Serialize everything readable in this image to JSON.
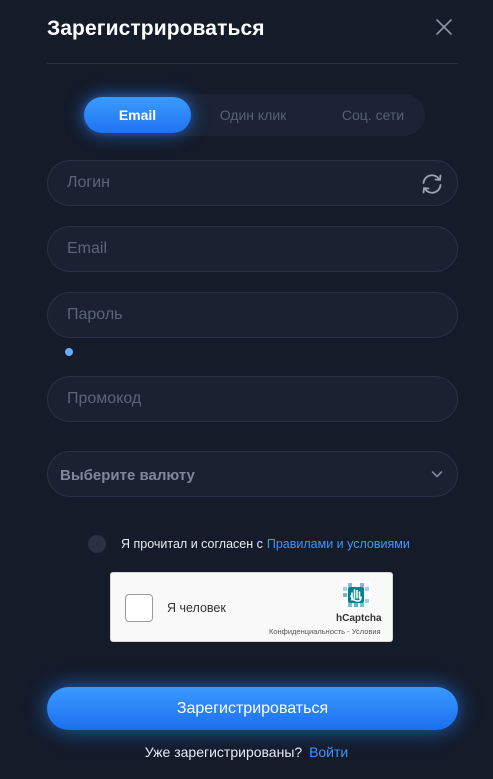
{
  "header": {
    "title": "Зарегистрироваться",
    "close_icon": "close-icon"
  },
  "tabs": [
    {
      "label": "Email",
      "active": true
    },
    {
      "label": "Один клик",
      "active": false
    },
    {
      "label": "Соц. сети",
      "active": false
    }
  ],
  "form": {
    "login": {
      "placeholder": "Логин",
      "value": "",
      "icon": "refresh-icon"
    },
    "email": {
      "placeholder": "Email",
      "value": ""
    },
    "password": {
      "placeholder": "Пароль",
      "value": ""
    },
    "promo": {
      "placeholder": "Промокод",
      "value": ""
    },
    "currency": {
      "label": "Выберите валюту",
      "icon": "chevron-down-icon"
    }
  },
  "agreement": {
    "text": "Я прочитал и согласен с",
    "link": "Правилами и условиями",
    "checked": false
  },
  "captcha": {
    "label": "Я человек",
    "brand": "hCaptcha",
    "links": "Конфиденциальность - Условия",
    "checked": false
  },
  "submit_label": "Зарегистрироваться",
  "footer": {
    "text": "Уже зарегистрированы?",
    "link": "Войти"
  },
  "colors": {
    "background": "#141b29",
    "field": "#1a2131",
    "accent": "#1f73f0",
    "link": "#3f94ff"
  }
}
